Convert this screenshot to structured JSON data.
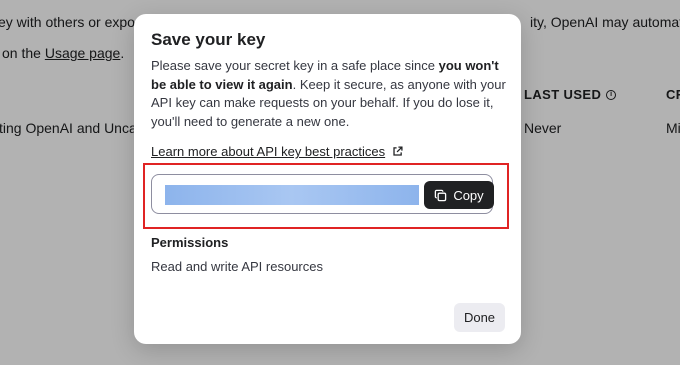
{
  "background": {
    "line1_left": "ey with others or expose i",
    "line1_right": "ity, OpenAI may automaticall",
    "line2_prefix": "on the ",
    "line2_link": "Usage page",
    "line2_suffix": ".",
    "table": {
      "headers": {
        "last_used": "LAST USED",
        "created": "CR"
      },
      "row": {
        "name": "ting OpenAI and Uncanny",
        "last_used": "Never",
        "created": "Mi"
      }
    }
  },
  "modal": {
    "title": "Save your key",
    "description": {
      "part1": "Please save your secret key in a safe place since ",
      "bold": "you won't be able to view it again",
      "part2": ". Keep it secure, as anyone with your API key can make requests on your behalf. If you do lose it, you'll need to generate a new one."
    },
    "best_practices_link": "Learn more about API key best practices",
    "key_field": {
      "value": "",
      "redacted": true
    },
    "copy_label": "Copy",
    "permissions_title": "Permissions",
    "permissions_value": "Read and write API resources",
    "done_label": "Done"
  },
  "colors": {
    "highlight_border": "#e02424",
    "copy_button_bg": "#202123",
    "redaction": "#a9c7f2"
  },
  "icons": {
    "external_link": "external-link-icon",
    "copy": "copy-icon",
    "info": "info-icon"
  }
}
